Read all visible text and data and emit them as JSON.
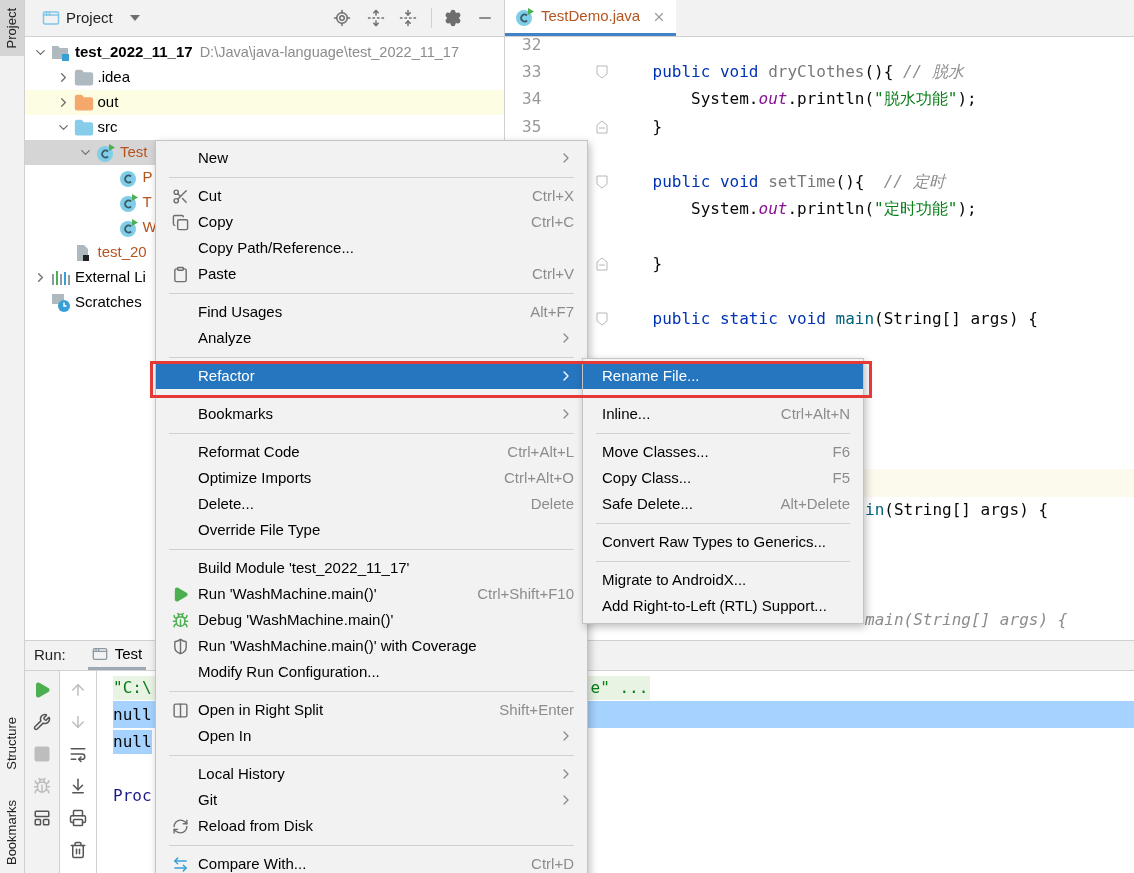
{
  "stripes": [
    {
      "label": "Project",
      "kind": "top",
      "selected": true
    },
    {
      "label": "Structure",
      "kind": "bottom",
      "selected": false
    },
    {
      "label": "Bookmarks",
      "kind": "bottom",
      "selected": false
    }
  ],
  "project": {
    "title": "Project",
    "tree": [
      {
        "label": "test_2022_11_17",
        "path": "D:\\Java\\java-language\\test_2022_11_17",
        "kind": "module",
        "expanded": true,
        "selected": false,
        "children": [
          {
            "label": ".idea",
            "kind": "folder",
            "expanded": false,
            "selected": false
          },
          {
            "label": "out",
            "kind": "excluded-folder",
            "expanded": false,
            "selected": false
          },
          {
            "label": "src",
            "kind": "source-folder",
            "expanded": true,
            "selected": false,
            "children": [
              {
                "label": "Test",
                "kind": "class",
                "runnable": true,
                "expanded": true,
                "selected": true,
                "color": "#b5541f",
                "children": [
                  {
                    "label": "P",
                    "kind": "class",
                    "runnable": false,
                    "selected": false,
                    "color": "#b5541f"
                  },
                  {
                    "label": "T",
                    "kind": "class",
                    "runnable": true,
                    "selected": false,
                    "color": "#b5541f"
                  },
                  {
                    "label": "W",
                    "kind": "class",
                    "runnable": true,
                    "selected": false,
                    "color": "#b5541f"
                  }
                ]
              }
            ]
          },
          {
            "label": "test_20",
            "kind": "file",
            "selected": false,
            "color": "#b5541f"
          }
        ]
      },
      {
        "label": "External Li",
        "kind": "libraries",
        "expanded": false,
        "selected": false
      },
      {
        "label": "Scratches",
        "kind": "scratches",
        "selected": false
      }
    ]
  },
  "editor": {
    "tabs": [
      {
        "label": "TestDemo.java",
        "selected": true
      }
    ],
    "lines": [
      {
        "number": "32",
        "kind": "blank"
      },
      {
        "number": "33",
        "kind": "fold-start",
        "tokens": [
          {
            "text": "    public void ",
            "kind": "keyword"
          },
          {
            "text": "dryClothes",
            "kind": "unused"
          },
          {
            "text": "(){ ",
            "kind": "plain"
          },
          {
            "text": "// 脱水",
            "kind": "comment"
          }
        ]
      },
      {
        "number": "34",
        "kind": "code",
        "tokens": [
          {
            "text": "        System.",
            "kind": "plain"
          },
          {
            "text": "out",
            "kind": "static-field"
          },
          {
            "text": ".println(",
            "kind": "plain"
          },
          {
            "text": "\"脱水功能\"",
            "kind": "string"
          },
          {
            "text": ");",
            "kind": "plain"
          }
        ]
      },
      {
        "number": "35",
        "kind": "fold-end",
        "tokens": [
          {
            "text": "    }",
            "kind": "plain"
          }
        ]
      },
      {
        "kind": "blank"
      },
      {
        "kind": "fold-start",
        "tokens": [
          {
            "text": "    public void ",
            "kind": "keyword"
          },
          {
            "text": "setTime",
            "kind": "unused"
          },
          {
            "text": "(){  ",
            "kind": "plain"
          },
          {
            "text": "// 定时",
            "kind": "comment"
          }
        ]
      },
      {
        "kind": "code",
        "tokens": [
          {
            "text": "        System.",
            "kind": "plain"
          },
          {
            "text": "out",
            "kind": "static-field"
          },
          {
            "text": ".println(",
            "kind": "plain"
          },
          {
            "text": "\"定时功能\"",
            "kind": "string"
          },
          {
            "text": ");",
            "kind": "plain"
          }
        ]
      },
      {
        "kind": "blank"
      },
      {
        "kind": "fold-end",
        "tokens": [
          {
            "text": "    }",
            "kind": "plain"
          }
        ]
      },
      {
        "kind": "blank"
      },
      {
        "kind": "fold-start",
        "tokens": [
          {
            "text": "    public static void ",
            "kind": "keyword"
          },
          {
            "text": "main",
            "kind": "declaration"
          },
          {
            "text": "(String[] args) {",
            "kind": "plain"
          }
        ]
      },
      {
        "kind": "blank"
      },
      {
        "kind": "blank"
      },
      {
        "kind": "blank"
      },
      {
        "kind": "blank"
      },
      {
        "kind": "blank"
      },
      {
        "kind": "current"
      },
      {
        "kind": "clipped",
        "tokens": [
          {
            "text": "in",
            "kind": "declaration"
          },
          {
            "text": "(String[] args) {",
            "kind": "plain"
          }
        ]
      },
      {
        "kind": "blank"
      },
      {
        "kind": "blank"
      },
      {
        "kind": "blank"
      },
      {
        "kind": "clipped",
        "tokens": [
          {
            "text": "main(String[] args) {",
            "kind": "comment"
          }
        ]
      }
    ]
  },
  "run": {
    "label": "Run:",
    "tabs": [
      {
        "label": "Test",
        "selected": true
      }
    ],
    "toolbar": [
      {
        "disabled": false
      },
      {
        "disabled": false
      },
      {
        "disabled": true
      },
      {
        "disabled": true
      },
      {
        "disabled": false
      },
      {
        "disabled": true
      },
      {
        "disabled": true
      },
      {
        "disabled": false
      },
      {
        "disabled": false
      },
      {
        "disabled": false
      },
      {
        "disabled": false
      }
    ],
    "console": [
      {
        "kind": "command",
        "text": "\"C:\\",
        "tail": "e\" ...",
        "selected": false
      },
      {
        "kind": "output",
        "text": "null",
        "selected": true
      },
      {
        "kind": "output",
        "text": "null",
        "selected": true
      },
      {
        "kind": "blank"
      },
      {
        "kind": "system",
        "text": "Proc",
        "selected": false
      }
    ]
  },
  "context_menu": {
    "items": [
      {
        "kind": "item",
        "label": "New",
        "submenu": true,
        "selected": false
      },
      {
        "kind": "separator"
      },
      {
        "kind": "item",
        "label": "Cut",
        "shortcut": "Ctrl+X",
        "submenu": false,
        "selected": false
      },
      {
        "kind": "item",
        "label": "Copy",
        "shortcut": "Ctrl+C",
        "submenu": false,
        "selected": false
      },
      {
        "kind": "item",
        "label": "Copy Path/Reference...",
        "submenu": false,
        "selected": false
      },
      {
        "kind": "item",
        "label": "Paste",
        "shortcut": "Ctrl+V",
        "submenu": false,
        "selected": false
      },
      {
        "kind": "separator"
      },
      {
        "kind": "item",
        "label": "Find Usages",
        "shortcut": "Alt+F7",
        "submenu": false,
        "selected": false
      },
      {
        "kind": "item",
        "label": "Analyze",
        "submenu": true,
        "selected": false
      },
      {
        "kind": "separator"
      },
      {
        "kind": "item",
        "label": "Refactor",
        "submenu": true,
        "selected": true
      },
      {
        "kind": "separator"
      },
      {
        "kind": "item",
        "label": "Bookmarks",
        "submenu": true,
        "selected": false
      },
      {
        "kind": "separator"
      },
      {
        "kind": "item",
        "label": "Reformat Code",
        "shortcut": "Ctrl+Alt+L",
        "submenu": false,
        "selected": false
      },
      {
        "kind": "item",
        "label": "Optimize Imports",
        "shortcut": "Ctrl+Alt+O",
        "submenu": false,
        "selected": false
      },
      {
        "kind": "item",
        "label": "Delete...",
        "shortcut": "Delete",
        "submenu": false,
        "selected": false
      },
      {
        "kind": "item",
        "label": "Override File Type",
        "submenu": false,
        "selected": false
      },
      {
        "kind": "separator"
      },
      {
        "kind": "item",
        "label": "Build Module 'test_2022_11_17'",
        "submenu": false,
        "selected": false
      },
      {
        "kind": "item",
        "label": "Run 'WashMachine.main()'",
        "shortcut": "Ctrl+Shift+F10",
        "submenu": false,
        "selected": false
      },
      {
        "kind": "item",
        "label": "Debug 'WashMachine.main()'",
        "submenu": false,
        "selected": false
      },
      {
        "kind": "item",
        "label": "Run 'WashMachine.main()' with Coverage",
        "submenu": false,
        "selected": false
      },
      {
        "kind": "item",
        "label": "Modify Run Configuration...",
        "submenu": false,
        "selected": false
      },
      {
        "kind": "separator"
      },
      {
        "kind": "item",
        "label": "Open in Right Split",
        "shortcut": "Shift+Enter",
        "submenu": false,
        "selected": false
      },
      {
        "kind": "item",
        "label": "Open In",
        "submenu": true,
        "selected": false
      },
      {
        "kind": "separator"
      },
      {
        "kind": "item",
        "label": "Local History",
        "submenu": true,
        "selected": false
      },
      {
        "kind": "item",
        "label": "Git",
        "submenu": true,
        "selected": false
      },
      {
        "kind": "item",
        "label": "Reload from Disk",
        "submenu": false,
        "selected": false
      },
      {
        "kind": "separator"
      },
      {
        "kind": "item",
        "label": "Compare With...",
        "shortcut": "Ctrl+D",
        "submenu": false,
        "selected": false
      }
    ]
  },
  "submenu": {
    "items": [
      {
        "kind": "item",
        "label": "Rename File...",
        "selected": true
      },
      {
        "kind": "separator"
      },
      {
        "kind": "item",
        "label": "Inline...",
        "shortcut": "Ctrl+Alt+N",
        "selected": false
      },
      {
        "kind": "separator"
      },
      {
        "kind": "item",
        "label": "Move Classes...",
        "shortcut": "F6",
        "selected": false
      },
      {
        "kind": "item",
        "label": "Copy Class...",
        "shortcut": "F5",
        "selected": false
      },
      {
        "kind": "item",
        "label": "Safe Delete...",
        "shortcut": "Alt+Delete",
        "selected": false
      },
      {
        "kind": "separator"
      },
      {
        "kind": "item",
        "label": "Convert Raw Types to Generics...",
        "selected": false
      },
      {
        "kind": "separator"
      },
      {
        "kind": "item",
        "label": "Migrate to AndroidX...",
        "selected": false
      },
      {
        "kind": "item",
        "label": "Add Right-to-Left (RTL) Support...",
        "selected": false
      }
    ]
  }
}
